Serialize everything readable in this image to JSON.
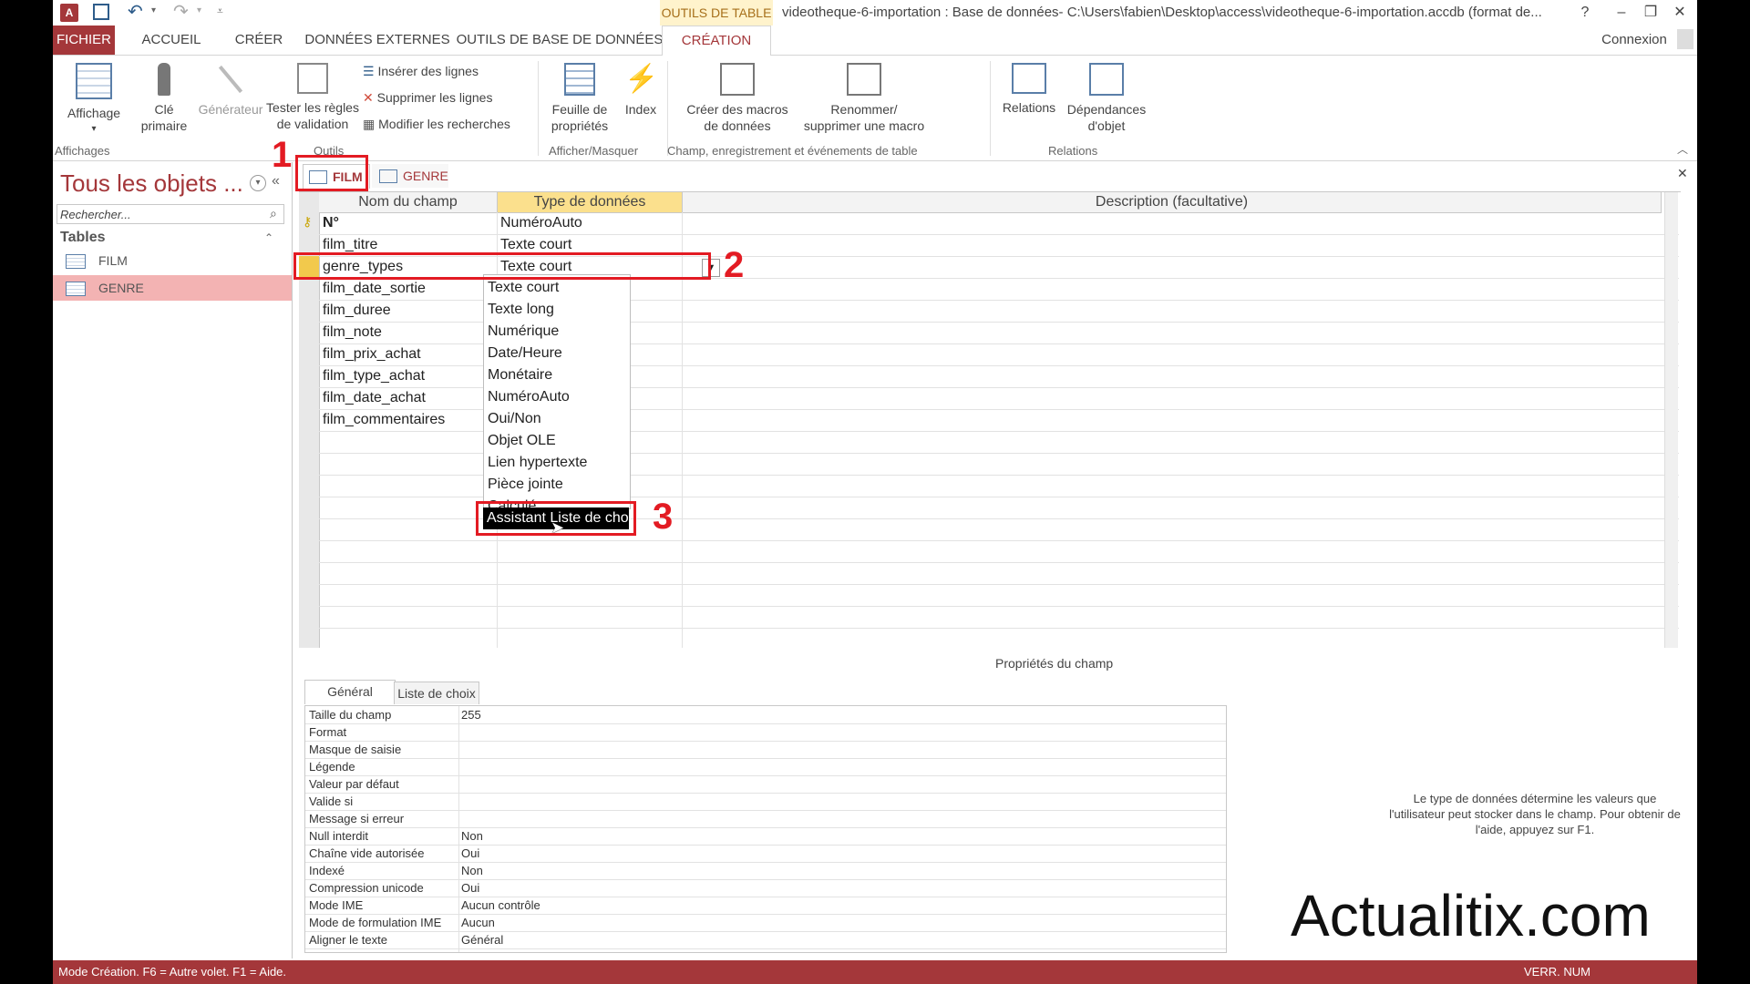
{
  "titlebar": {
    "app_icon": "access-icon",
    "context_tab": "OUTILS DE TABLE",
    "title": "videotheque-6-importation : Base de données- C:\\Users\\fabien\\Desktop\\access\\videotheque-6-importation.accdb (format de...",
    "help": "?",
    "minimize": "–",
    "restore": "❐",
    "close": "✕"
  },
  "ribbon_tabs": [
    "FICHIER",
    "ACCUEIL",
    "CRÉER",
    "DONNÉES EXTERNES",
    "OUTILS DE BASE DE DONNÉES",
    "CRÉATION"
  ],
  "account": "Connexion",
  "ribbon": {
    "affichage": "Affichage",
    "cle_primaire": "Clé\nprimaire",
    "generateur": "Générateur",
    "tester": "Tester les règles\nde validation",
    "inserer": "Insérer des lignes",
    "supprimer": "Supprimer les lignes",
    "modifier": "Modifier les recherches",
    "feuille": "Feuille de\npropriétés",
    "index": "Index",
    "creer_macros": "Créer des macros\nde données",
    "renommer": "Renommer/\nsupprimer une macro",
    "relations": "Relations",
    "dependances": "Dépendances\nd'objet",
    "groups": {
      "affichages": "Affichages",
      "outils": "Outils",
      "afficher_masquer": "Afficher/Masquer",
      "champ": "Champ, enregistrement et événements de table",
      "relations": "Relations"
    }
  },
  "nav": {
    "title": "Tous les objets ...",
    "search_placeholder": "Rechercher...",
    "group": "Tables",
    "items": [
      "FILM",
      "GENRE"
    ]
  },
  "doc_tabs": [
    "FILM",
    "GENRE"
  ],
  "grid": {
    "headers": [
      "Nom du champ",
      "Type de données",
      "Description (facultative)"
    ],
    "rows": [
      {
        "name": "N°",
        "type": "NuméroAuto"
      },
      {
        "name": "film_titre",
        "type": "Texte court"
      },
      {
        "name": "genre_types",
        "type": "Texte court"
      },
      {
        "name": "film_date_sortie",
        "type": ""
      },
      {
        "name": "film_duree",
        "type": ""
      },
      {
        "name": "film_note",
        "type": ""
      },
      {
        "name": "film_prix_achat",
        "type": ""
      },
      {
        "name": "film_type_achat",
        "type": ""
      },
      {
        "name": "film_date_achat",
        "type": ""
      },
      {
        "name": "film_commentaires",
        "type": ""
      }
    ]
  },
  "dropdown_options": [
    "Texte court",
    "Texte long",
    "Numérique",
    "Date/Heure",
    "Monétaire",
    "NuméroAuto",
    "Oui/Non",
    "Objet OLE",
    "Lien hypertexte",
    "Pièce jointe",
    "Calculé",
    "Assistant Liste de choix..."
  ],
  "annotations": [
    "1",
    "2",
    "3"
  ],
  "props": {
    "title": "Propriétés du champ",
    "tabs": [
      "Général",
      "Liste de choix"
    ],
    "rows": [
      {
        "label": "Taille du champ",
        "value": "255"
      },
      {
        "label": "Format",
        "value": ""
      },
      {
        "label": "Masque de saisie",
        "value": ""
      },
      {
        "label": "Légende",
        "value": ""
      },
      {
        "label": "Valeur par défaut",
        "value": ""
      },
      {
        "label": "Valide si",
        "value": ""
      },
      {
        "label": "Message si erreur",
        "value": ""
      },
      {
        "label": "Null interdit",
        "value": "Non"
      },
      {
        "label": "Chaîne vide autorisée",
        "value": "Oui"
      },
      {
        "label": "Indexé",
        "value": "Non"
      },
      {
        "label": "Compression unicode",
        "value": "Oui"
      },
      {
        "label": "Mode IME",
        "value": "Aucun contrôle"
      },
      {
        "label": "Mode de formulation IME",
        "value": "Aucun"
      },
      {
        "label": "Aligner le texte",
        "value": "Général"
      }
    ],
    "help": "Le type de données détermine les valeurs que l'utilisateur peut stocker dans le champ. Pour obtenir de l'aide, appuyez sur F1."
  },
  "watermark": "Actualitix.com",
  "status": {
    "left": "Mode Création. F6 = Autre volet. F1 = Aide.",
    "right": "VERR. NUM"
  },
  "colors": {
    "accent": "#a4373a",
    "highlight": "#fde9a6",
    "annotation": "#e31b23"
  }
}
